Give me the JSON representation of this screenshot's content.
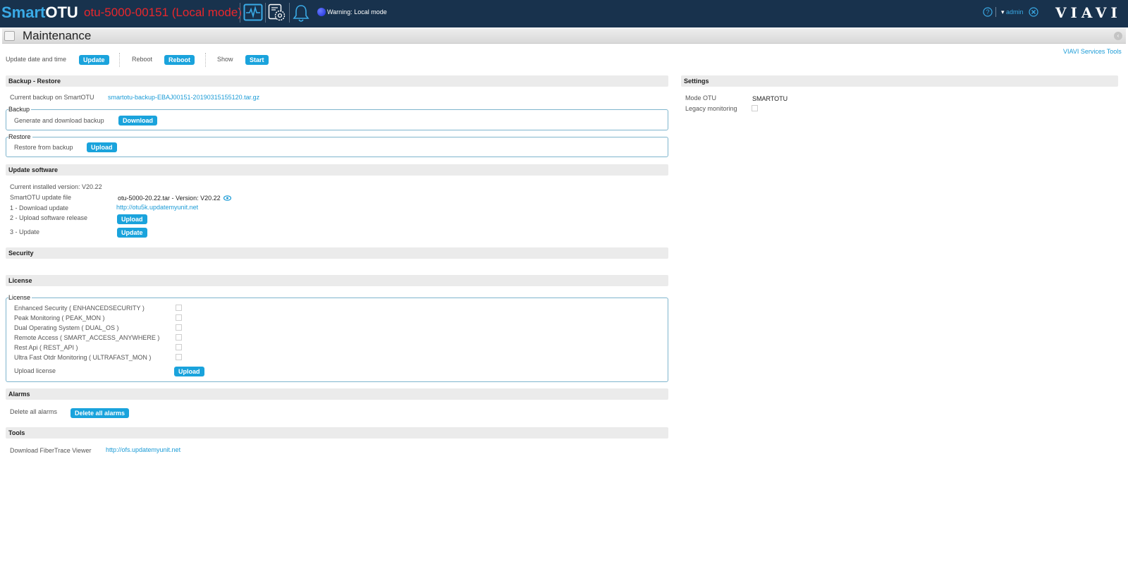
{
  "app": {
    "brand_primary": "Smart",
    "brand_secondary": "OTU",
    "device_title": "otu-5000-00151 (Local mode)",
    "warning_label": "Warning:",
    "warning_text": "Local mode",
    "user": "admin",
    "logo": "VIAVI"
  },
  "page": {
    "title": "Maintenance",
    "services_link": "VIAVI Services Tools"
  },
  "toolbar": {
    "update_label": "Update date and time",
    "update_button": "Update",
    "reboot_label": "Reboot",
    "reboot_button": "Reboot",
    "show_label": "Show",
    "show_button": "Start"
  },
  "backup_restore": {
    "header": "Backup - Restore",
    "current_label": "Current backup on SmartOTU",
    "current_file": "smartotu-backup-EBAJ00151-20190315155120.tar.gz",
    "backup_legend": "Backup",
    "backup_text": "Generate and download backup",
    "backup_button": "Download",
    "restore_legend": "Restore",
    "restore_text": "Restore from backup",
    "restore_button": "Upload"
  },
  "update_software": {
    "header": "Update software",
    "installed": "Current installed version: V20.22",
    "file_label": "SmartOTU update file",
    "file_value": "otu-5000-20.22.tar - Version: V20.22",
    "step1_label": "1 - Download update",
    "step1_link": "http://otu5k.updatemyunit.net",
    "step2_label": "2 - Upload software release",
    "step2_button": "Upload",
    "step3_label": "3 - Update",
    "step3_button": "Update"
  },
  "security": {
    "header": "Security"
  },
  "license": {
    "header": "License",
    "legend": "License",
    "items": [
      {
        "label": "Enhanced Security ( ENHANCEDSECURITY )",
        "checked": false
      },
      {
        "label": "Peak Monitoring ( PEAK_MON )",
        "checked": false
      },
      {
        "label": "Dual Operating System ( DUAL_OS )",
        "checked": false
      },
      {
        "label": "Remote Access ( SMART_ACCESS_ANYWHERE )",
        "checked": false
      },
      {
        "label": "Rest Api ( REST_API )",
        "checked": false
      },
      {
        "label": "Ultra Fast Otdr Monitoring ( ULTRAFAST_MON )",
        "checked": false
      }
    ],
    "upload_label": "Upload license",
    "upload_button": "Upload"
  },
  "alarms": {
    "header": "Alarms",
    "delete_label": "Delete all alarms",
    "delete_button": "Delete all alarms"
  },
  "tools": {
    "header": "Tools",
    "viewer_label": "Download FiberTrace Viewer",
    "viewer_link": "http://ofs.updatemyunit.net"
  },
  "settings": {
    "header": "Settings",
    "mode_label": "Mode OTU",
    "mode_value": "SMARTOTU",
    "legacy_label": "Legacy monitoring",
    "legacy_checked": false
  },
  "colors": {
    "topbar": "#18324d",
    "brand_blue": "#3aaae6",
    "device_red": "#e8272c",
    "button": "#1aa3dc",
    "link": "#1b9bd6",
    "fieldset_border": "#7fb5cd"
  },
  "icons": [
    "monitoring-icon",
    "settings-gear-icon",
    "bell-icon",
    "warning-status-icon",
    "help-icon",
    "logout-icon",
    "page-icon",
    "collapse-icon",
    "view-file-icon"
  ]
}
